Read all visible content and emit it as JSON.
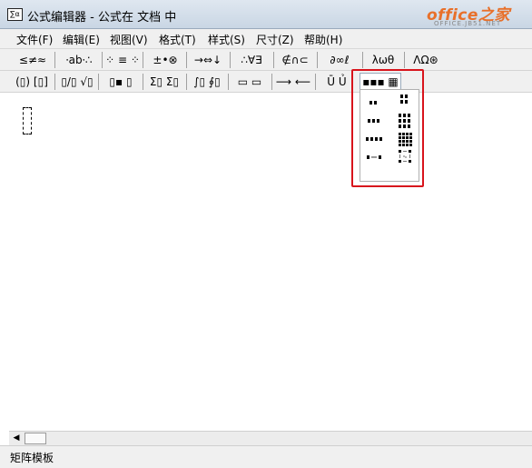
{
  "window": {
    "title": "公式编辑器 - 公式在 文档  中",
    "app_icon_text": "∑α"
  },
  "watermark": {
    "main": "office之家",
    "sub": "OFFICE.JB51.NET"
  },
  "menu": [
    {
      "label": "文件(F)"
    },
    {
      "label": "编辑(E)"
    },
    {
      "label": "视图(V)"
    },
    {
      "label": "格式(T)"
    },
    {
      "label": "样式(S)"
    },
    {
      "label": "尺寸(Z)"
    },
    {
      "label": "帮助(H)"
    }
  ],
  "toolbar_row1": [
    {
      "label": "≤≠≈",
      "icon": "relational-symbols-icon"
    },
    {
      "label": "⸱ab⸱∴",
      "icon": "spaces-ellipses-icon"
    },
    {
      "label": "⁘ ≡ ⁘",
      "icon": "embellishments-icon"
    },
    {
      "label": "±•⊗",
      "icon": "operator-symbols-icon"
    },
    {
      "label": "→⇔↓",
      "icon": "arrow-symbols-icon"
    },
    {
      "label": "∴∀∃",
      "icon": "logical-symbols-icon"
    },
    {
      "label": "∉∩⊂",
      "icon": "set-theory-symbols-icon"
    },
    {
      "label": "∂∞ℓ",
      "icon": "misc-symbols-icon"
    },
    {
      "label": "λωθ",
      "icon": "greek-lowercase-icon"
    },
    {
      "label": "ΛΩ⊛",
      "icon": "greek-uppercase-icon"
    }
  ],
  "toolbar_row2": [
    {
      "label": "(▯) [▯]",
      "icon": "fence-templates-icon"
    },
    {
      "label": "▯/▯ √▯",
      "icon": "fraction-radical-templates-icon"
    },
    {
      "label": "▯▪ ▯",
      "icon": "subscript-superscript-templates-icon"
    },
    {
      "label": "Σ▯ Σ▯",
      "icon": "summation-templates-icon"
    },
    {
      "label": "∫▯ ∮▯",
      "icon": "integral-templates-icon"
    },
    {
      "label": "▭ ▭",
      "icon": "underbar-overbar-templates-icon"
    },
    {
      "label": "⟶ ⟵",
      "icon": "labeled-arrow-templates-icon"
    },
    {
      "label": "Ū Ủ",
      "icon": "products-set-theory-templates-icon"
    },
    {
      "label": "▪▪▪ ▦",
      "icon": "matrix-templates-icon"
    }
  ],
  "status": {
    "text": "矩阵模板"
  }
}
